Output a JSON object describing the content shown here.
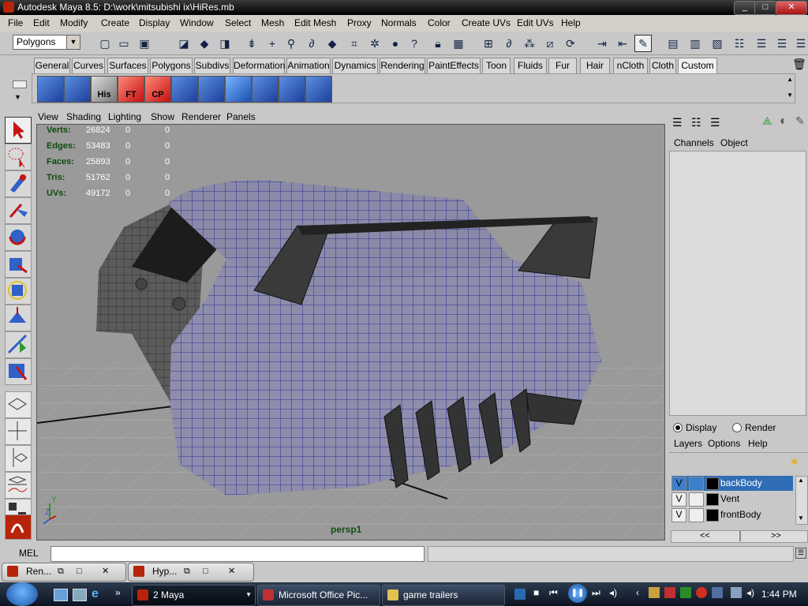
{
  "window": {
    "title": "Autodesk Maya 8.5: D:\\work\\mitsubishi ix\\HiRes.mb",
    "min": "_",
    "max": "□",
    "close": "✕"
  },
  "menu": [
    "File",
    "Edit",
    "Modify",
    "Create",
    "Display",
    "Window",
    "Select",
    "Mesh",
    "Edit Mesh",
    "Proxy",
    "Normals",
    "Color",
    "Create UVs",
    "Edit UVs",
    "Help"
  ],
  "mode_selector": {
    "value": "Polygons"
  },
  "shelf_tabs": [
    "General",
    "Curves",
    "Surfaces",
    "Polygons",
    "Subdivs",
    "Deformation",
    "Animation",
    "Dynamics",
    "Rendering",
    "PaintEffects",
    "Toon",
    "Fluids",
    "Fur",
    "Hair",
    "nCloth",
    "Cloth",
    "Custom"
  ],
  "active_shelf_tab": "Custom",
  "shelf_icons": [
    "",
    "",
    "His",
    "FT",
    "CP",
    "",
    "",
    "",
    "",
    "",
    ""
  ],
  "panel_menu": [
    "View",
    "Shading",
    "Lighting",
    "Show",
    "Renderer",
    "Panels"
  ],
  "hud": {
    "rows": [
      {
        "label": "Verts:",
        "v1": "26824",
        "v2": "0",
        "v3": "0"
      },
      {
        "label": "Edges:",
        "v1": "53483",
        "v2": "0",
        "v3": "0"
      },
      {
        "label": "Faces:",
        "v1": "25893",
        "v2": "0",
        "v3": "0"
      },
      {
        "label": "Tris:",
        "v1": "51762",
        "v2": "0",
        "v3": "0"
      },
      {
        "label": "UVs:",
        "v1": "49172",
        "v2": "0",
        "v3": "0"
      }
    ],
    "camera": "persp1",
    "axis_y": "Y",
    "axis_z": "Z"
  },
  "channel_box": {
    "menu": [
      "Channels",
      "Object"
    ]
  },
  "layer_editor": {
    "display_radio": "Display",
    "render_radio": "Render",
    "menu": [
      "Layers",
      "Options",
      "Help"
    ],
    "layers": [
      {
        "vis": "V",
        "name": "backBody",
        "selected": true
      },
      {
        "vis": "V",
        "name": "Vent",
        "selected": false
      },
      {
        "vis": "V",
        "name": "frontBody",
        "selected": false
      }
    ],
    "scroll_left": "<<",
    "scroll_right": ">>"
  },
  "command_line": {
    "label": "MEL"
  },
  "minimized": [
    {
      "title": "Ren..."
    },
    {
      "title": "Hyp..."
    }
  ],
  "taskbar": {
    "tasks": [
      {
        "label": "2 Maya"
      },
      {
        "label": "Microsoft Office Pic..."
      },
      {
        "label": "game trailers"
      }
    ],
    "clock": "1:44 PM"
  },
  "colors": {
    "wire": "#14148c",
    "hud_green": "#0c4c0c",
    "viewport_bg": "#9a9a9a",
    "selected_layer": "#2f6db5"
  }
}
